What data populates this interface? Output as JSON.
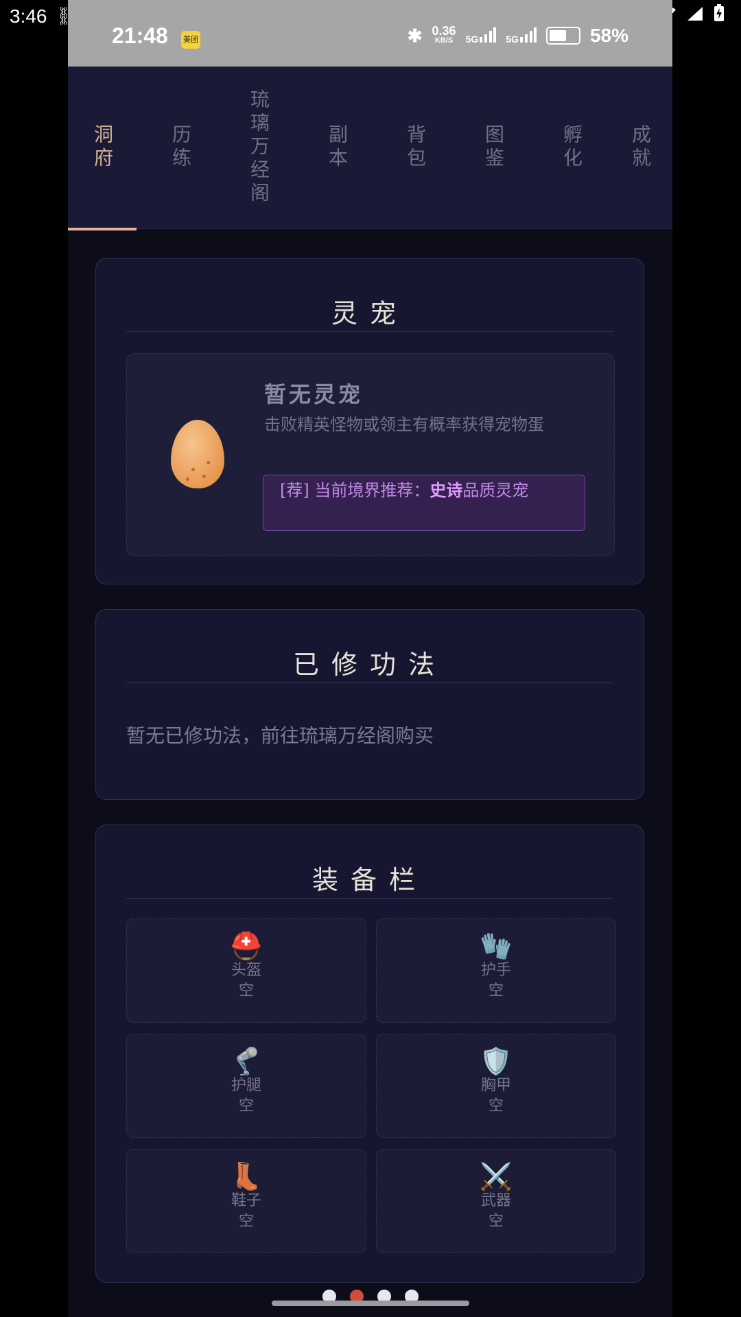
{
  "outer_status": {
    "time": "3:46",
    "bug_icon": "bug-icon"
  },
  "inner_status": {
    "time": "21:48",
    "badge": "美团",
    "speed_value": "0.36",
    "speed_unit": "KB/S",
    "net1": "5G",
    "net2": "5G",
    "battery": "58%"
  },
  "tabs": [
    {
      "label": "洞府",
      "active": true
    },
    {
      "label": "历练"
    },
    {
      "label": "琉璃万经阁"
    },
    {
      "label": "副本"
    },
    {
      "label": "背包"
    },
    {
      "label": "图鉴"
    },
    {
      "label": "孵化"
    },
    {
      "label": "成就"
    }
  ],
  "pet": {
    "title": "灵宠",
    "empty_title": "暂无灵宠",
    "desc": "击败精英怪物或领主有概率获得宠物蛋",
    "rec_prefix": "[荐] 当前境界推荐：",
    "rec_quality": "史诗",
    "rec_suffix": "品质灵宠"
  },
  "skills": {
    "title": "已修功法",
    "empty": "暂无已修功法，前往琉璃万经阁购买"
  },
  "equipment": {
    "title": "装备栏",
    "slots": [
      {
        "name": "头盔",
        "status": "空",
        "icon": "⛑️"
      },
      {
        "name": "护手",
        "status": "空",
        "icon": "🧤"
      },
      {
        "name": "护腿",
        "status": "空",
        "icon": "🦿"
      },
      {
        "name": "胸甲",
        "status": "空",
        "icon": "🛡️"
      },
      {
        "name": "鞋子",
        "status": "空",
        "icon": "👢"
      },
      {
        "name": "武器",
        "status": "空",
        "icon": "⚔️"
      }
    ]
  },
  "pager": {
    "count": 4,
    "active_index": 1
  }
}
